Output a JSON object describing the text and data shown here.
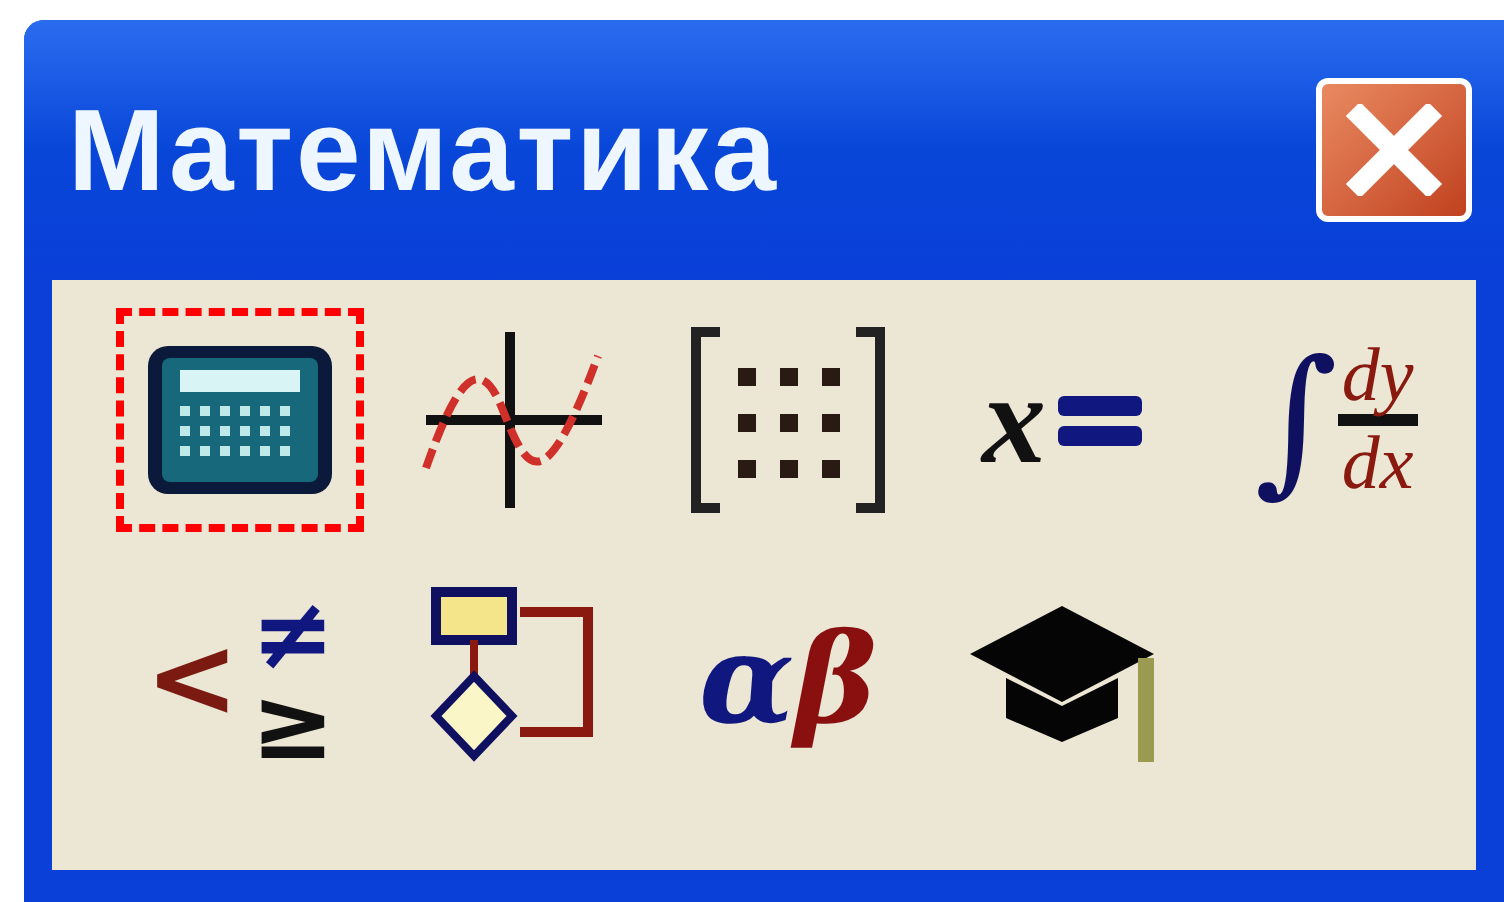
{
  "window": {
    "title": "Математика"
  },
  "toolbar": [
    {
      "kind": "calculator",
      "selected": true
    },
    {
      "kind": "graph",
      "selected": false
    },
    {
      "kind": "matrix",
      "selected": false
    },
    {
      "kind": "evaluation",
      "selected": false,
      "glyphs": [
        "x"
      ]
    },
    {
      "kind": "calculus",
      "selected": false,
      "glyphs": [
        "∫",
        "dy",
        "dx"
      ]
    },
    {
      "kind": "boolean",
      "selected": false,
      "glyphs": [
        "<",
        "≠",
        "≥"
      ]
    },
    {
      "kind": "programming",
      "selected": false
    },
    {
      "kind": "greek",
      "selected": false,
      "glyphs": [
        "α",
        "β"
      ]
    },
    {
      "kind": "symbolic",
      "selected": false
    }
  ]
}
